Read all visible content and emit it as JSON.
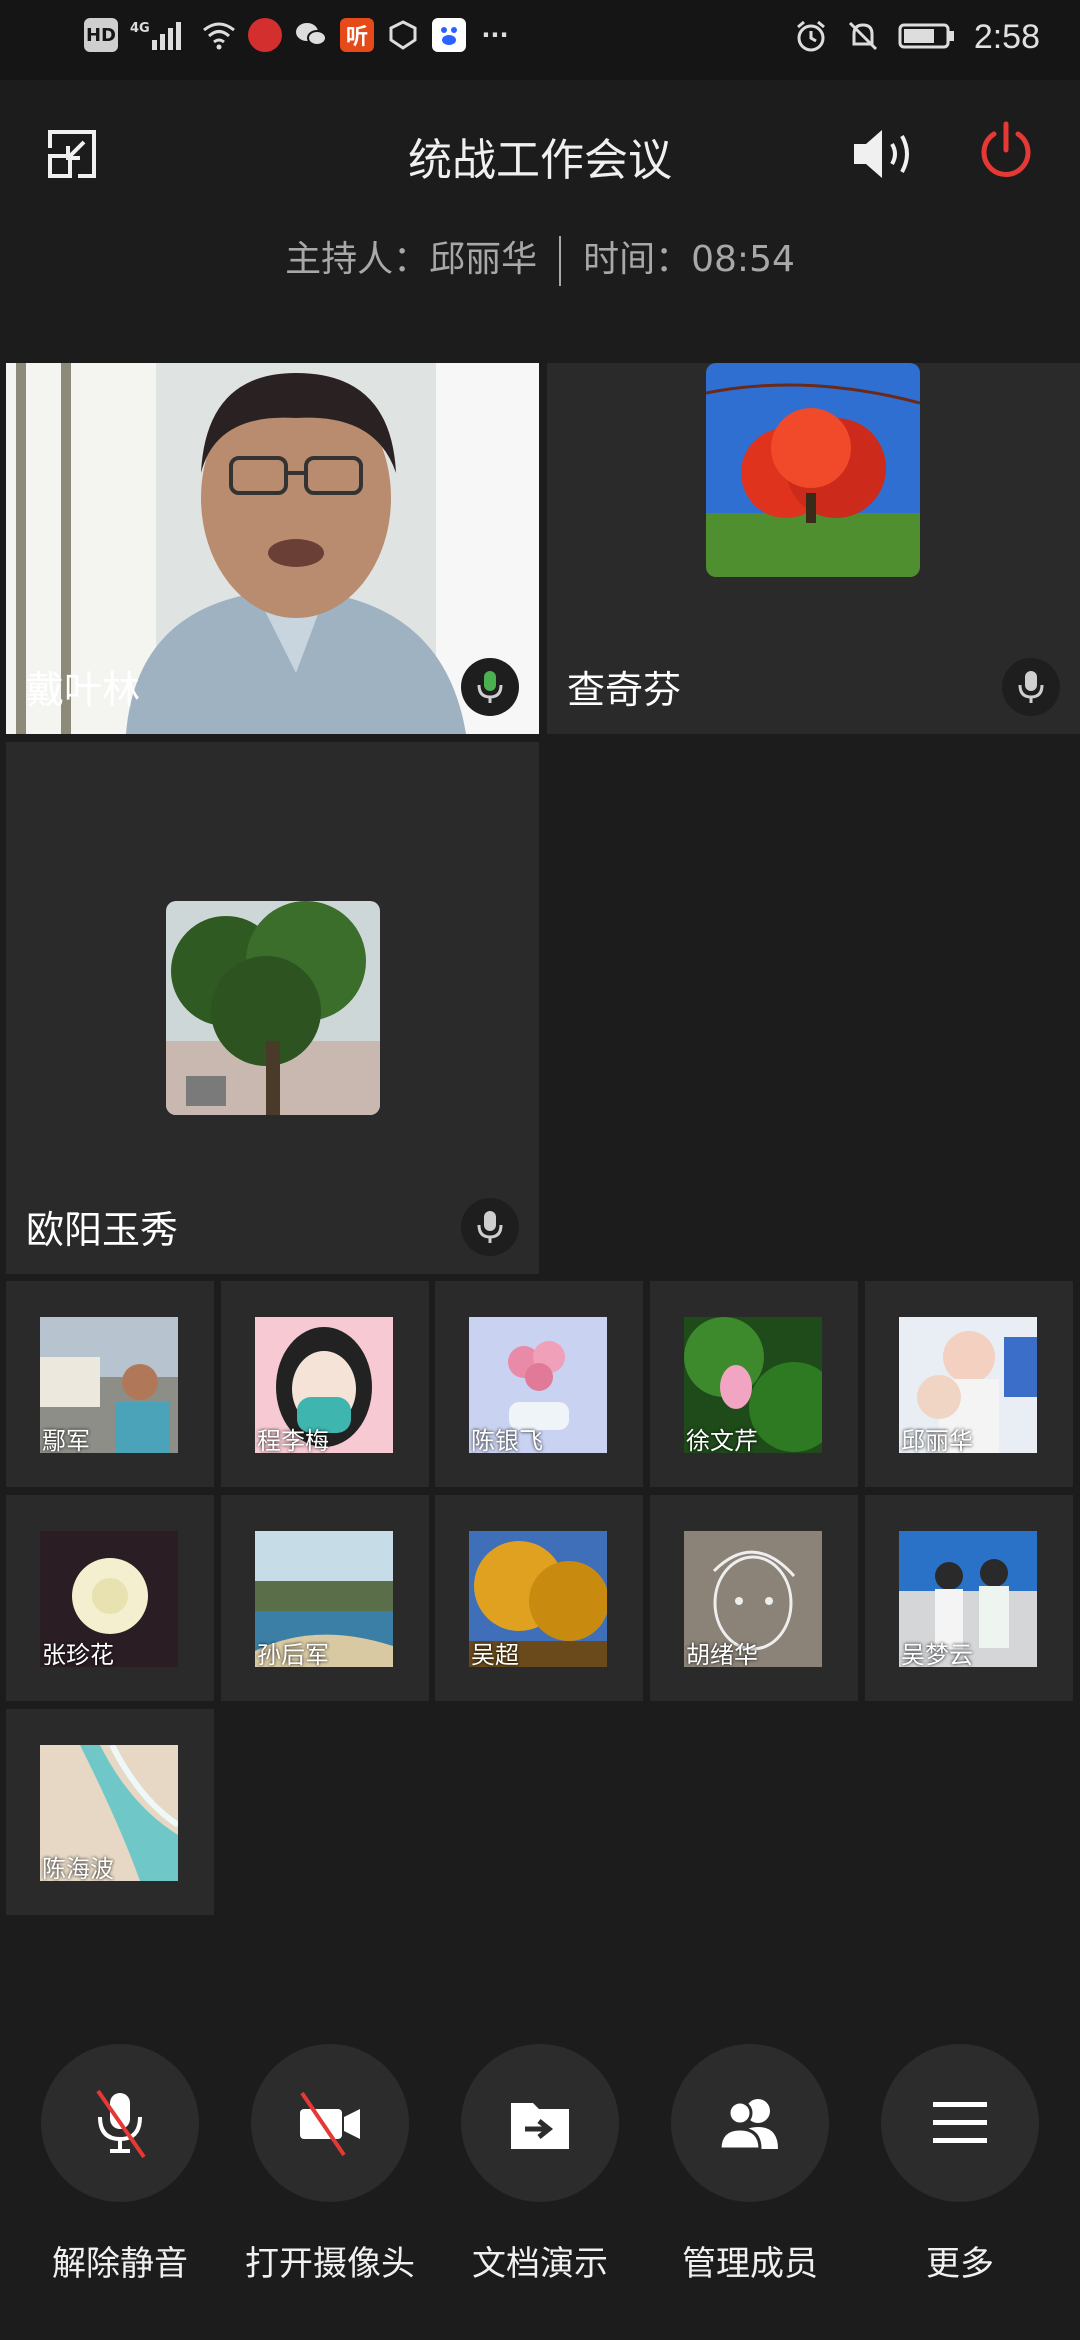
{
  "status_bar": {
    "left_icons": [
      "hd-icon",
      "4g-signal-icon",
      "wifi-icon",
      "news-app-icon",
      "wechat-icon",
      "listen-app-icon",
      "shield-app-icon",
      "baidu-icon",
      "more-dots-icon"
    ],
    "hd_label": "HD",
    "net_label": "4G",
    "listen_label": "听",
    "more_label": "···",
    "right_icons": [
      "alarm-icon",
      "mute-bell-icon",
      "battery-icon"
    ],
    "time": "2:58"
  },
  "header": {
    "title": "统战工作会议",
    "host_label": "主持人：邱丽华",
    "time_label": "时间：08:54"
  },
  "main_tiles": [
    {
      "name": "戴叶林",
      "mic": "active"
    },
    {
      "name": "查奇芬",
      "mic": "idle"
    },
    {
      "name": "欧阳玉秀",
      "mic": "idle"
    }
  ],
  "participants": [
    {
      "name": "鄢军"
    },
    {
      "name": "程李梅"
    },
    {
      "name": "陈银飞"
    },
    {
      "name": "徐文芹"
    },
    {
      "name": "邱丽华"
    },
    {
      "name": "张珍花"
    },
    {
      "name": "孙后军"
    },
    {
      "name": "吴超"
    },
    {
      "name": "胡绪华"
    },
    {
      "name": "吴梦云"
    },
    {
      "name": "陈海波"
    }
  ],
  "controls": [
    {
      "label": "解除静音",
      "icon": "mic-muted-icon"
    },
    {
      "label": "打开摄像头",
      "icon": "camera-off-icon"
    },
    {
      "label": "文档演示",
      "icon": "share-document-icon"
    },
    {
      "label": "管理成员",
      "icon": "members-icon"
    },
    {
      "label": "更多",
      "icon": "menu-icon"
    }
  ],
  "colors": {
    "background": "#1c1c1c",
    "tile": "#2a2a2a",
    "power_red": "#e53935",
    "mic_active_green": "#4caf50"
  }
}
